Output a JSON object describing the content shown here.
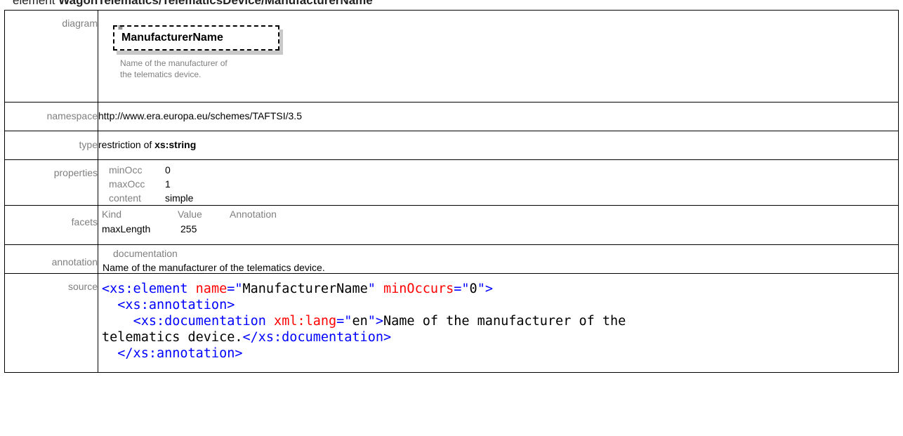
{
  "heading": {
    "prefix": "element ",
    "path": "WagonTelematics/TelematicsDevice/ManufacturerName"
  },
  "rows": {
    "diagram": {
      "label": "diagram",
      "element_name": "ManufacturerName",
      "description": "Name of the manufacturer of the telematics device."
    },
    "namespace": {
      "label": "namespace",
      "value": "http://www.era.europa.eu/schemes/TAFTSI/3.5"
    },
    "type": {
      "label": "type",
      "prefix": "restriction of ",
      "base": "xs:string"
    },
    "properties": {
      "label": "properties",
      "items": [
        {
          "key": "minOcc",
          "value": "0"
        },
        {
          "key": "maxOcc",
          "value": "1"
        },
        {
          "key": "content",
          "value": "simple"
        }
      ]
    },
    "facets": {
      "label": "facets",
      "headers": {
        "kind": "Kind",
        "value": "Value",
        "annotation": "Annotation"
      },
      "row": {
        "kind": "maxLength",
        "value": "255",
        "annotation": ""
      }
    },
    "annotation": {
      "label": "annotation",
      "heading": "documentation",
      "text": "Name of the manufacturer of the telematics device."
    },
    "source": {
      "label": "source",
      "line1_open": "<xs:element",
      "line1_attr1": " name",
      "line1_eq1": "=\"",
      "line1_val1": "ManufacturerName",
      "line1_q1": "\"",
      "line1_attr2": " minOccurs",
      "line1_eq2": "=\"",
      "line1_val2": "0",
      "line1_q2": "\"",
      "line1_close": ">",
      "line2": "  <xs:annotation>",
      "line3_indent": "    ",
      "line3_open": "<xs:documentation",
      "line3_attr": " xml:lang",
      "line3_eq": "=\"",
      "line3_val": "en",
      "line3_q": "\"",
      "line3_gt": ">",
      "line3_text": "Name of the manufacturer of the",
      "line4_text": "telematics device.",
      "line4_close": "</xs:documentation>",
      "line5": "  </xs:annotation>"
    }
  }
}
